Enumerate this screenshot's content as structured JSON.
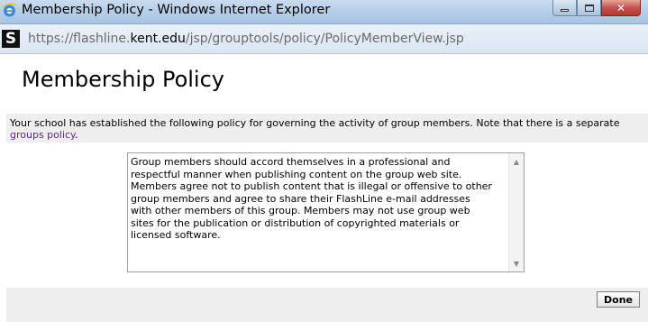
{
  "window": {
    "title": "Membership Policy - Windows Internet Explorer",
    "icon": "ie-icon",
    "controls": [
      "minimize",
      "maximize",
      "close"
    ]
  },
  "address_bar": {
    "site_icon_letter": "S",
    "url_prefix": "https://flashline.",
    "url_domain": "kent.edu",
    "url_path": "/jsp/grouptools/policy/PolicyMemberView.jsp"
  },
  "page": {
    "title": "Membership Policy",
    "notice_text": "Your school has established the following policy for governing the activity of group members. Note that there is a separate",
    "notice_link": "groups policy",
    "notice_end": ".",
    "policy_text": "Group members should accord themselves in a professional and\nrespectful manner when publishing content on the group web site.\nMembers agree not to publish content that is illegal or offensive to other\ngroup members and agree to share their FlashLine e-mail addresses\nwith other members of this group. Members may not use group web\nsites for the publication or distribution of copyrighted materials or\nlicensed software.",
    "done_label": "Done"
  },
  "colors": {
    "link": "#5b2a86",
    "panel_gray": "#eeeeee"
  }
}
